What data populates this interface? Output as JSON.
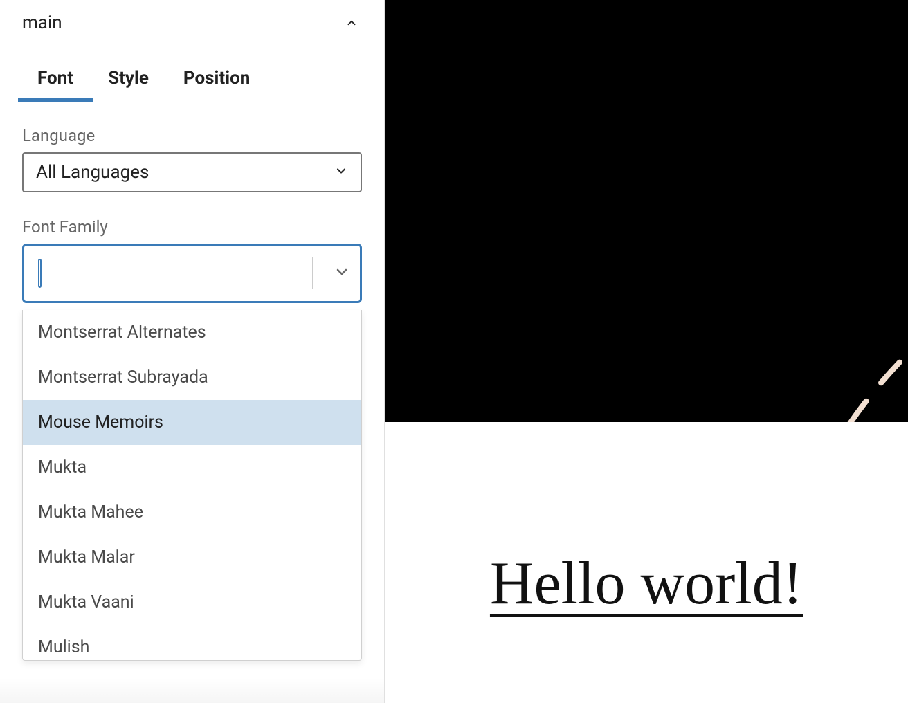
{
  "panel": {
    "section_title": "main",
    "tabs": [
      {
        "label": "Font",
        "active": true
      },
      {
        "label": "Style",
        "active": false
      },
      {
        "label": "Position",
        "active": false
      }
    ],
    "language_label": "Language",
    "language_value": "All Languages",
    "font_family_label": "Font Family",
    "font_family_value": "",
    "dropdown": {
      "highlighted_index": 2,
      "options": [
        "Montserrat Alternates",
        "Montserrat Subrayada",
        "Mouse Memoirs",
        "Mukta",
        "Mukta Mahee",
        "Mukta Malar",
        "Mukta Vaani",
        "Mulish"
      ]
    }
  },
  "preview": {
    "heading": "Hello world!"
  },
  "colors": {
    "accent": "#3a7bb8",
    "highlight_bg": "#cfe0ee",
    "dash_stroke": "#f3e0d2"
  }
}
